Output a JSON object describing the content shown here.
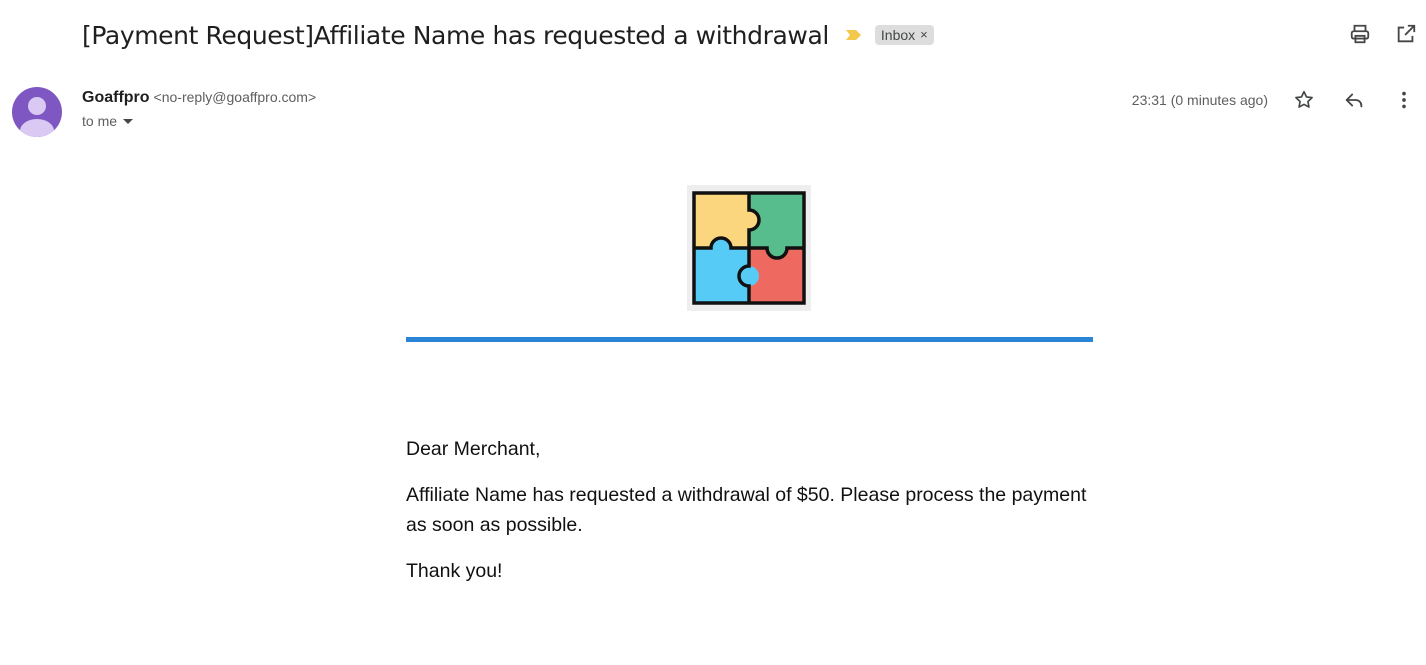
{
  "email": {
    "subject": "[Payment Request]Affiliate Name has requested a withdrawal",
    "label": "Inbox",
    "label_remove": "×",
    "importance_color": "#f2c94c",
    "sender": {
      "name": "Goaffpro",
      "email": "<no-reply@goaffpro.com>",
      "avatar_color": "#7e57c2"
    },
    "to_text": "to me",
    "timestamp": "23:31 (0 minutes ago)",
    "top_actions": [
      "print-icon",
      "open-in-new-window-icon"
    ],
    "row_actions": [
      "star-icon",
      "reply-icon",
      "more-vertical-icon"
    ]
  },
  "body": {
    "logo": "puzzle-logo",
    "accent_color": "#2a85d6",
    "greeting": "Dear Merchant,",
    "message": "Affiliate Name has requested a withdrawal of $50. Please process the payment as soon as possible.",
    "closing": "Thank you!"
  }
}
